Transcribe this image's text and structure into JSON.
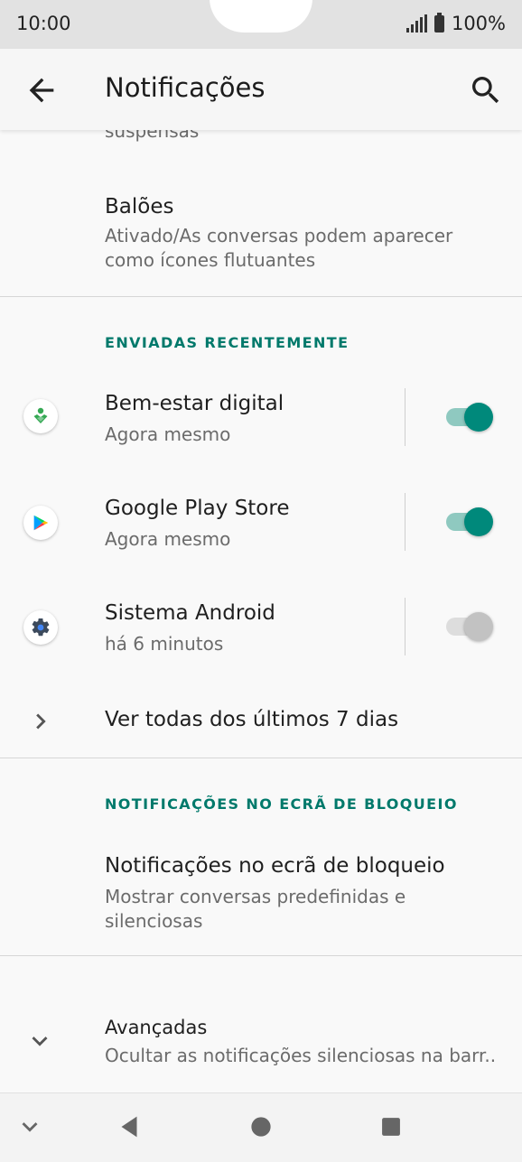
{
  "status_bar": {
    "time": "10:00",
    "battery": "100%"
  },
  "app_bar": {
    "title": "Notificações"
  },
  "top_partial": {
    "text": "suspensas"
  },
  "baloes": {
    "title": "Balões",
    "subtitle_line1": "Ativado/As conversas podem aparecer",
    "subtitle_line2": "como ícones flutuantes"
  },
  "recent": {
    "header": "ENVIADAS RECENTEMENTE",
    "items": [
      {
        "name": "Bem-estar digital",
        "time": "Agora mesmo",
        "icon": "digital-wellbeing-icon",
        "enabled": true
      },
      {
        "name": "Google Play Store",
        "time": "Agora mesmo",
        "icon": "google-play-icon",
        "enabled": true
      },
      {
        "name": "Sistema Android",
        "time": "há 6 minutos",
        "icon": "android-system-gear-icon",
        "enabled": false
      }
    ],
    "see_all": "Ver todas dos últimos 7 dias"
  },
  "lockscreen": {
    "header": "NOTIFICAÇÕES NO ECRÃ DE BLOQUEIO",
    "title": "Notificações no ecrã de bloqueio",
    "subtitle_line1": "Mostrar conversas predefinidas e",
    "subtitle_line2": "silenciosas"
  },
  "advanced": {
    "title": "Avançadas",
    "subtitle": "Ocultar as notificações silenciosas na barr.."
  },
  "colors": {
    "accent": "#00897b",
    "header": "#00796b"
  }
}
